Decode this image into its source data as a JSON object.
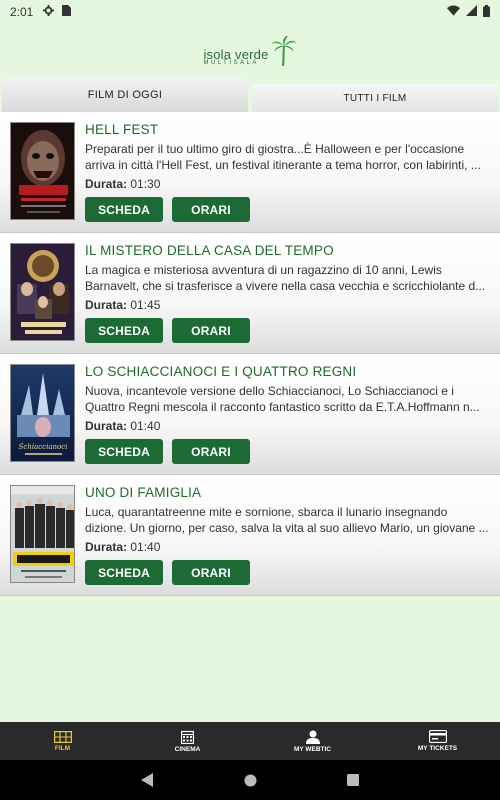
{
  "status_bar": {
    "time": "2:01"
  },
  "logo": {
    "main": "isola verde",
    "sub": "MULTISALA",
    "tagline": "multisala isolaverde"
  },
  "tabs": [
    {
      "label": "FILM DI OGGI",
      "active": true
    },
    {
      "label": "TUTTI I FILM",
      "active": false
    }
  ],
  "movies": [
    {
      "title": "HELL FEST",
      "description": "Preparati per il tuo ultimo giro di giostra...È Halloween e per l'occasione arriva in città l'Hell Fest, un festival itinerante a tema horror, con labirinti, ...",
      "duration_label": "Durata:",
      "duration": "01:30",
      "btn_scheda": "SCHEDA",
      "btn_orari": "ORARI"
    },
    {
      "title": "IL MISTERO DELLA CASA DEL TEMPO",
      "description": "La magica e misteriosa avventura di un ragazzino di 10 anni, Lewis Barnavelt, che si trasferisce a vivere nella casa vecchia e scricchiolante d...",
      "duration_label": "Durata:",
      "duration": "01:45",
      "btn_scheda": "SCHEDA",
      "btn_orari": "ORARI"
    },
    {
      "title": "LO SCHIACCIANOCI E I QUATTRO REGNI",
      "description": "Nuova, incantevole versione dello Schiaccianoci, Lo Schiaccianoci e i Quattro Regni mescola il racconto fantastico scritto da E.T.A.Hoffmann n...",
      "duration_label": "Durata:",
      "duration": "01:40",
      "btn_scheda": "SCHEDA",
      "btn_orari": "ORARI"
    },
    {
      "title": "UNO DI FAMIGLIA",
      "description": "Luca, quarantatreenne mite e sornione, sbarca il lunario insegnando dizione. Un giorno, per caso, salva la vita al suo allievo Mario, un giovane ...",
      "duration_label": "Durata:",
      "duration": "01:40",
      "btn_scheda": "SCHEDA",
      "btn_orari": "ORARI"
    }
  ],
  "bottom_nav": [
    {
      "label": "FILM",
      "icon": "film-icon",
      "active": true
    },
    {
      "label": "CINEMA",
      "icon": "calendar-icon",
      "active": false
    },
    {
      "label": "MY WEBTIC",
      "icon": "user-icon",
      "active": false
    },
    {
      "label": "MY TICKETS",
      "icon": "ticket-icon",
      "active": false
    }
  ],
  "colors": {
    "accent_green": "#1d6b34",
    "title_green": "#1f6b2d",
    "active_nav": "#e8c43a",
    "background": "#e6f7df"
  }
}
